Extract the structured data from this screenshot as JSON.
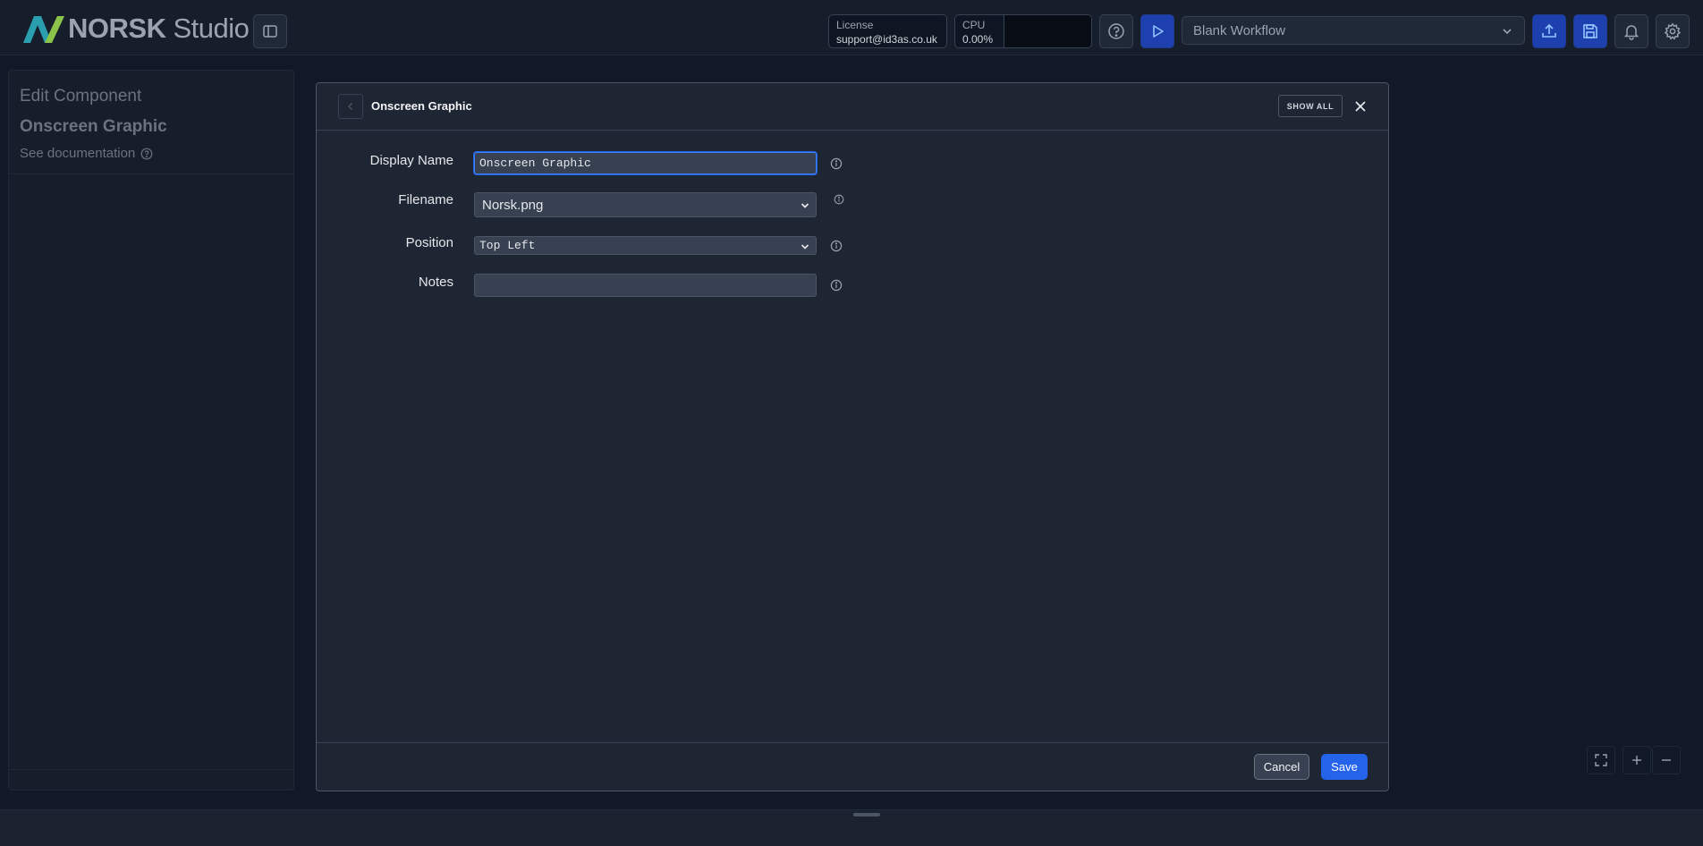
{
  "app": {
    "brand_bold": "NORSK",
    "brand_light": "Studio"
  },
  "header": {
    "license_label": "License",
    "license_value": "support@id3as.co.uk",
    "cpu_label": "CPU",
    "cpu_value": "0.00%",
    "workflow_selected": "Blank Workflow"
  },
  "left_panel": {
    "heading": "Edit Component",
    "component_title": "Onscreen Graphic",
    "doc_link": "See documentation"
  },
  "modal": {
    "title": "Onscreen Graphic",
    "show_all_label": "SHOW ALL",
    "fields": {
      "display_name": {
        "label": "Display Name",
        "value": "Onscreen Graphic"
      },
      "filename": {
        "label": "Filename",
        "value": "Norsk.png"
      },
      "position": {
        "label": "Position",
        "value": "Top Left"
      },
      "notes": {
        "label": "Notes",
        "value": ""
      }
    },
    "cancel_label": "Cancel",
    "save_label": "Save"
  },
  "colors": {
    "accent_blue": "#2563eb",
    "logo_teal": "#2a9fb0",
    "logo_green": "#8bc34a"
  }
}
